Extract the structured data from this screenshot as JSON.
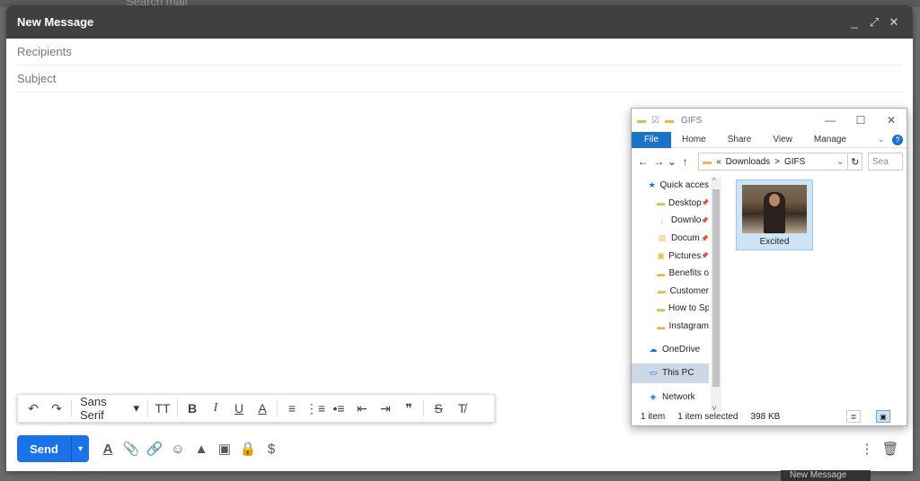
{
  "background": {
    "search_placeholder": "Search mail"
  },
  "compose": {
    "title": "New Message",
    "controls": {
      "minimize": "_",
      "fullscreen": "⤢",
      "close": "✕"
    },
    "recipients_placeholder": "Recipients",
    "subject_placeholder": "Subject",
    "send_label": "Send",
    "send_options": "▾",
    "formatting": {
      "font": "Sans Serif",
      "undo": "↶",
      "redo": "↷",
      "size": "TT",
      "bold": "B",
      "italic": "I",
      "underline": "U",
      "text_color": "A",
      "align": "≡",
      "numbered": "⋮≡",
      "bulleted": "•≡",
      "indent_less": "⇤",
      "indent_more": "⇥",
      "quote": "❞",
      "strikethrough": "S",
      "remove_format": "T̸"
    },
    "bottom_icons": {
      "format": "A",
      "attach": "📎",
      "link": "🔗",
      "emoji": "☺",
      "drive": "▲",
      "photo": "▣",
      "confidential": "🔒",
      "signature": "$",
      "more": "⋮",
      "discard": "🗑"
    }
  },
  "explorer": {
    "title": "GIFS",
    "window_controls": {
      "minimize": "—",
      "maximize": "☐",
      "close": "✕"
    },
    "ribbon": {
      "file": "File",
      "tabs": [
        "Home",
        "Share",
        "View",
        "Manage"
      ],
      "help": "?"
    },
    "nav": {
      "back": "←",
      "forward": "→",
      "recent": "⌄",
      "up": "↑"
    },
    "address": {
      "prefix": "«",
      "path": [
        "Downloads",
        "GIFS"
      ],
      "separator": ">",
      "refresh": "↻"
    },
    "search_placeholder": "Sea",
    "sidebar": [
      {
        "label": "Quick acces",
        "icon": "★",
        "pinned": false,
        "indent": 0
      },
      {
        "label": "Desktop",
        "icon": "▬",
        "pinned": true,
        "indent": 1
      },
      {
        "label": "Downlo",
        "icon": "↓",
        "pinned": true,
        "indent": 1
      },
      {
        "label": "Docum",
        "icon": "▤",
        "pinned": true,
        "indent": 1
      },
      {
        "label": "Pictures",
        "icon": "▣",
        "pinned": true,
        "indent": 1
      },
      {
        "label": "Benefits o",
        "icon": "▬",
        "pinned": false,
        "indent": 1
      },
      {
        "label": "Customer",
        "icon": "▬",
        "pinned": false,
        "indent": 1
      },
      {
        "label": "How to Sp",
        "icon": "▬",
        "pinned": false,
        "indent": 1
      },
      {
        "label": "Instagram",
        "icon": "▬",
        "pinned": false,
        "indent": 1
      },
      {
        "label": "",
        "icon": "",
        "pinned": false,
        "indent": 0
      },
      {
        "label": "OneDrive",
        "icon": "☁",
        "pinned": false,
        "indent": 0
      },
      {
        "label": "",
        "icon": "",
        "pinned": false,
        "indent": 0
      },
      {
        "label": "This PC",
        "icon": "▭",
        "pinned": false,
        "indent": 0
      },
      {
        "label": "",
        "icon": "",
        "pinned": false,
        "indent": 0
      },
      {
        "label": "Network",
        "icon": "◈",
        "pinned": false,
        "indent": 0
      }
    ],
    "selected_sidebar": "This PC",
    "file": {
      "name": "Excited"
    },
    "status": {
      "count": "1 item",
      "selected": "1 item selected",
      "size": "398 KB"
    }
  },
  "taskbar_tooltip": "New Message",
  "colors": {
    "accent": "#1a73e8",
    "header": "#404040",
    "explorer_accent": "#1a73c8"
  }
}
